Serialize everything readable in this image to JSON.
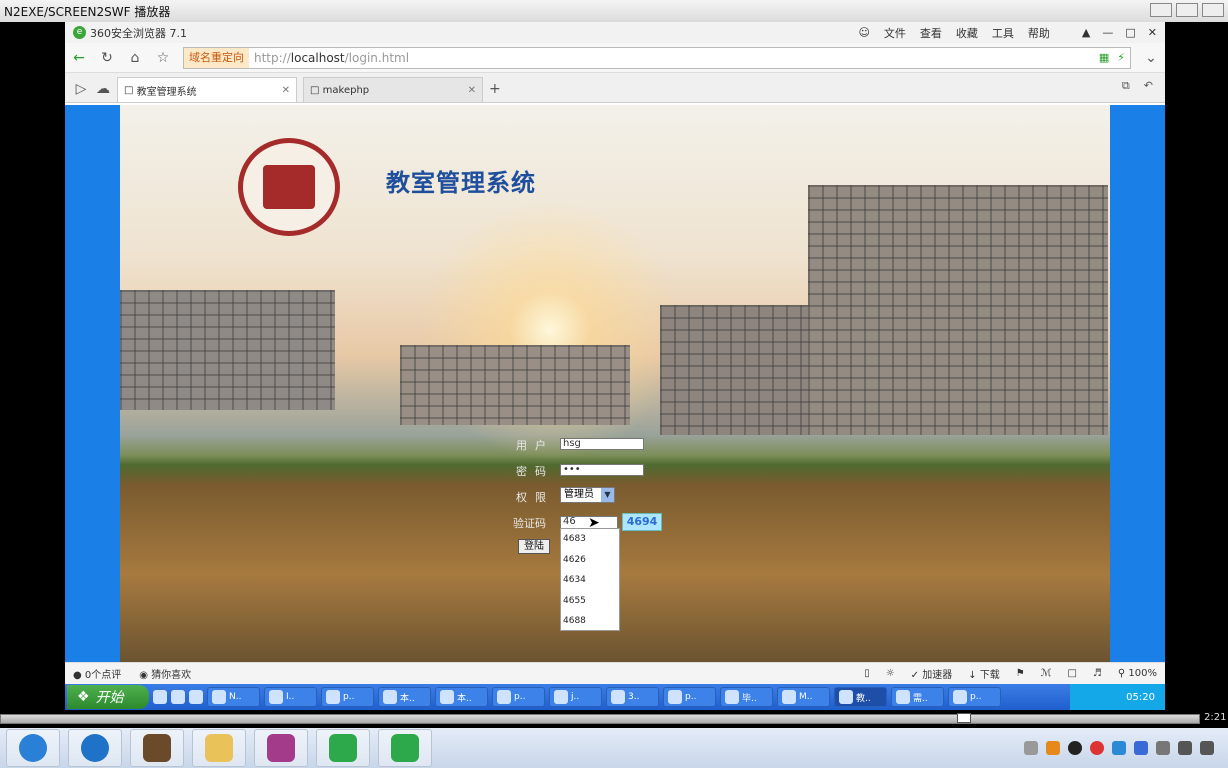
{
  "outer_window": {
    "title": "N2EXE/SCREEN2SWF 播放器"
  },
  "browser": {
    "title": "360安全浏览器 7.1",
    "menu": [
      "文件",
      "查看",
      "收藏",
      "工具",
      "帮助"
    ],
    "redirect_label": "域名重定向",
    "url_prefix": "http://",
    "url_host": "localhost",
    "url_path": "/login.html",
    "tabs": [
      {
        "label": "教室管理系统",
        "active": true
      },
      {
        "label": "makephp",
        "active": false
      }
    ]
  },
  "page": {
    "title": "教室管理系统",
    "form": {
      "user_label": "用户",
      "user_value": "hsg",
      "password_label": "密码",
      "password_value": "•••",
      "role_label": "权限",
      "role_value": "管理员",
      "captcha_label": "验证码",
      "captcha_value": "46",
      "captcha_code": "4694",
      "login_button": "登陆"
    },
    "autocomplete": [
      "4683",
      "4626",
      "4634",
      "4655",
      "4688"
    ]
  },
  "statusbar": {
    "comments": "0个点评",
    "guess": "猜你喜欢",
    "accelerator": "加速器",
    "download": "下载",
    "zoom": "100%"
  },
  "taskbar": {
    "start_label": "开始",
    "items": [
      "N..",
      "I..",
      "p..",
      "本..",
      "本..",
      "p..",
      "j..",
      "3..",
      "p..",
      "毕..",
      "M..",
      "教..",
      "需..",
      "p.."
    ],
    "clock": "05:20"
  },
  "player": {
    "time": "2:21"
  },
  "colors": {
    "title_blue": "#1f4f9c",
    "page_bg_blue": "#1a7fe6",
    "taskbar_blue": "#1f5fce"
  }
}
